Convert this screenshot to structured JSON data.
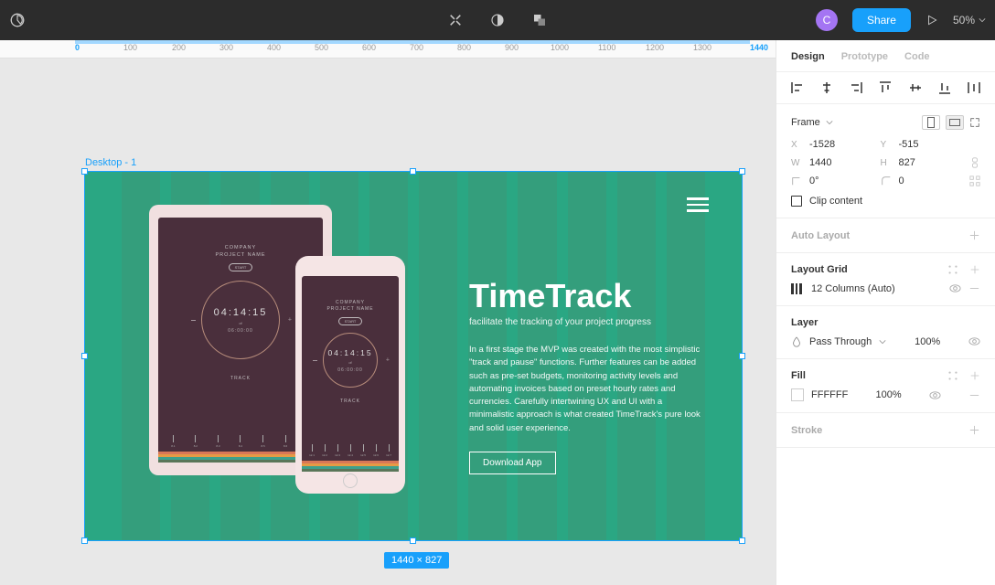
{
  "toolbar": {
    "avatar_letter": "C",
    "share_label": "Share",
    "zoom": "50%"
  },
  "ruler": {
    "origin": "0",
    "end": "1440",
    "ticks": [
      "100",
      "200",
      "300",
      "400",
      "500",
      "600",
      "700",
      "800",
      "900",
      "1000",
      "1100",
      "1200",
      "1300"
    ]
  },
  "frame": {
    "label": "Desktop - 1",
    "size_badge": "1440 × 827"
  },
  "mock": {
    "tablet": {
      "company": "COMPANY\nPROJECT NAME",
      "start": "START",
      "time": "04:14:15",
      "of": "of",
      "sub": "06:00:00",
      "track": "TRACK",
      "bars": [
        "8.1",
        "8.2",
        "8.3",
        "8.4",
        "8.5",
        "8.6",
        "8.7"
      ]
    },
    "phone": {
      "company": "COMPANY\nPROJECT NAME",
      "start": "START",
      "time": "04:14:15",
      "of": "of",
      "sub": "06:00:00",
      "track": "TRACK",
      "bars": [
        "12.1",
        "12.2",
        "12.3",
        "12.4",
        "12.5",
        "12.6",
        "12.7"
      ]
    },
    "content": {
      "title": "TimeTrack",
      "sub": "facilitate the tracking of your project progress",
      "body": "In a first stage the MVP was created with the most simplistic \"track and pause\" functions. Further features can be added such as pre-set budgets, monitoring activity levels and automating invoices based on preset hourly rates and currencies. Carefully intertwining UX and UI with a minimalistic approach is what created TimeTrack's pure look and solid user experience.",
      "cta": "Download App"
    }
  },
  "inspector": {
    "tabs": {
      "design": "Design",
      "prototype": "Prototype",
      "code": "Code"
    },
    "frame_label": "Frame",
    "x_label": "X",
    "x_val": "-1528",
    "y_label": "Y",
    "y_val": "-515",
    "w_label": "W",
    "w_val": "1440",
    "h_label": "H",
    "h_val": "827",
    "rot_val": "0°",
    "corner_val": "0",
    "clip": "Clip content",
    "auto_layout": "Auto Layout",
    "layout_grid": "Layout Grid",
    "grid_value": "12 Columns (Auto)",
    "layer": "Layer",
    "blend_mode": "Pass Through",
    "layer_opacity": "100%",
    "fill": "Fill",
    "fill_hex": "FFFFFF",
    "fill_opacity": "100%",
    "stroke": "Stroke"
  }
}
